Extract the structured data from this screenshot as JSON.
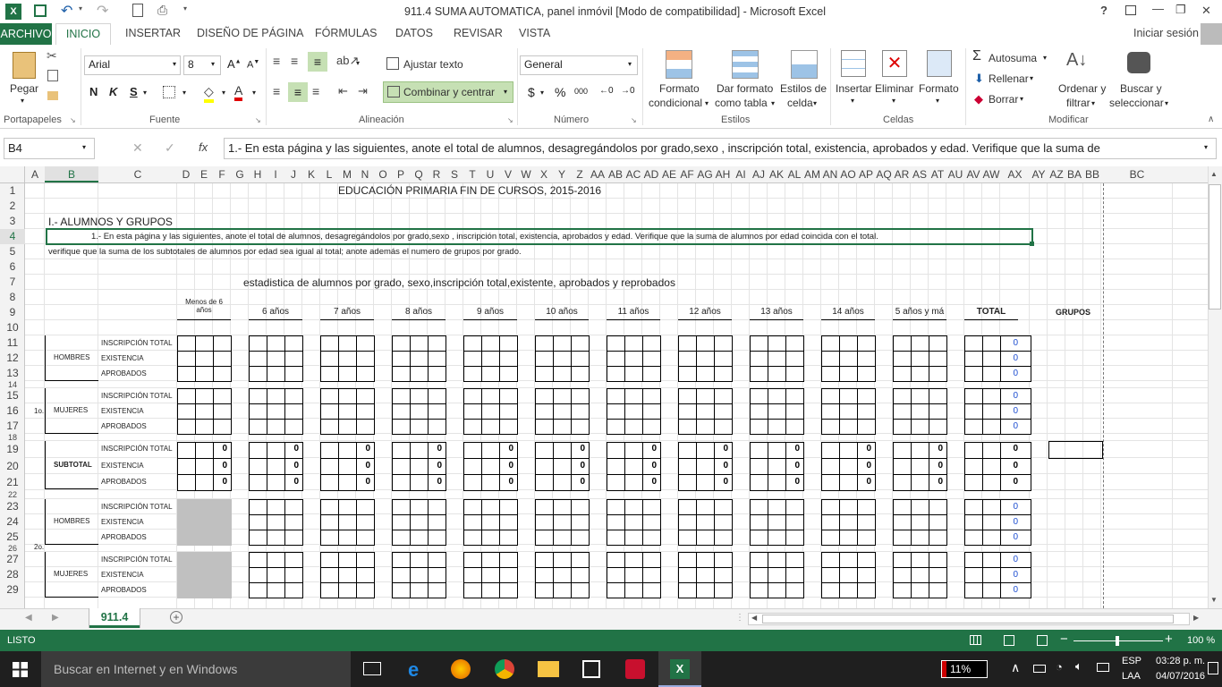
{
  "window": {
    "title": "911.4 SUMA AUTOMATICA, panel inmóvil  [Modo de compatibilidad] - Microsoft Excel",
    "help": "?",
    "minimize": "—",
    "restore": "❐",
    "close": "✕"
  },
  "tabs": {
    "archivo": "ARCHIVO",
    "inicio": "INICIO",
    "insertar": "INSERTAR",
    "diseno": "DISEÑO DE PÁGINA",
    "formulas": "FÓRMULAS",
    "datos": "DATOS",
    "revisar": "REVISAR",
    "vista": "VISTA",
    "signin": "Iniciar sesión"
  },
  "ribbon": {
    "paste": "Pegar",
    "clipboard": "Portapapeles",
    "font_name": "Arial",
    "font_size": "8",
    "bold": "N",
    "italic": "K",
    "underline": "S",
    "font": "Fuente",
    "wrap": "Ajustar texto",
    "merge": "Combinar y centrar",
    "alignment": "Alineación",
    "numfmt": "General",
    "currency": "$",
    "percent": "%",
    "thousands": "000",
    "number": "Número",
    "cond1": "Formato",
    "cond2": "condicional",
    "table1": "Dar formato",
    "table2": "como tabla",
    "cellst1": "Estilos de",
    "cellst2": "celda",
    "styles": "Estilos",
    "insert": "Insertar",
    "delete": "Eliminar",
    "format": "Formato",
    "cells": "Celdas",
    "autosum": "Autosuma",
    "fill": "Rellenar",
    "clear": "Borrar",
    "sort1": "Ordenar y",
    "sort2": "filtrar",
    "find1": "Buscar y",
    "find2": "seleccionar",
    "modify": "Modificar"
  },
  "formula": {
    "namebox": "B4",
    "fx": "fx",
    "content": "1.- En esta página y las siguientes, anote el total de alumnos, desagregándolos por grado,sexo , inscripción total, existencia, aprobados y edad. Verifique que la suma de"
  },
  "columns": [
    "A",
    "B",
    "C",
    "D",
    "E",
    "F",
    "G",
    "H",
    "I",
    "J",
    "K",
    "L",
    "M",
    "N",
    "O",
    "P",
    "Q",
    "R",
    "S",
    "T",
    "U",
    "V",
    "W",
    "X",
    "Y",
    "Z",
    "AA",
    "AB",
    "AC",
    "AD",
    "AE",
    "AF",
    "AG",
    "AH",
    "AI",
    "AJ",
    "AK",
    "AL",
    "AM",
    "AN",
    "AO",
    "AP",
    "AQ",
    "AR",
    "AS",
    "AT",
    "AU",
    "AV",
    "AW",
    "AX",
    "AY",
    "AZ",
    "BA",
    "BB",
    "BC"
  ],
  "sheet": {
    "title": "EDUCACIÓN PRIMARIA FIN DE CURSOS, 2015-2016",
    "section": "I.- ALUMNOS  Y  GRUPOS",
    "note1": "1.- En esta página y las siguientes, anote el total de alumnos, desagregándolos por grado,sexo , inscripción total, existencia, aprobados y edad. Verifique que la suma de alumnos por edad coincida con el total.",
    "note2": "verifique que la suma de los subtotales de alumnos por edad sea igual al total; anote además el numero  de grupos por grado.",
    "subtitle": "estadistica de alumnos por grado, sexo,inscripción total,existente, aprobados y reprobados",
    "ages": [
      "Menos de 6 años",
      "6 años",
      "7 años",
      "8 años",
      "9 años",
      "10 años",
      "11 años",
      "12 años",
      "13 años",
      "14 años",
      "5 años y má",
      "TOTAL"
    ],
    "grupos": "GRUPOS",
    "hombres": "HOMBRES",
    "mujeres": "MUJERES",
    "subtotal": "SUBTOTAL",
    "g1": "1o.",
    "g2": "2o.",
    "ins": "INSCRIPCIÓN TOTAL",
    "exi": "EXISTENCIA",
    "apr": "APROBADOS",
    "zero": "0"
  },
  "sheettab": "911.4",
  "status": {
    "ready": "LISTO",
    "zoom": "100 %"
  },
  "taskbar": {
    "search": "Buscar en Internet y en Windows",
    "battery": "11%",
    "lang1": "ESP",
    "lang2": "LAA",
    "time": "03:28 p. m.",
    "date": "04/07/2016"
  },
  "colors": {
    "accent": "#217346",
    "subtotal_gray": "#c0c0c0",
    "blue_value": "#1f4fd1"
  }
}
